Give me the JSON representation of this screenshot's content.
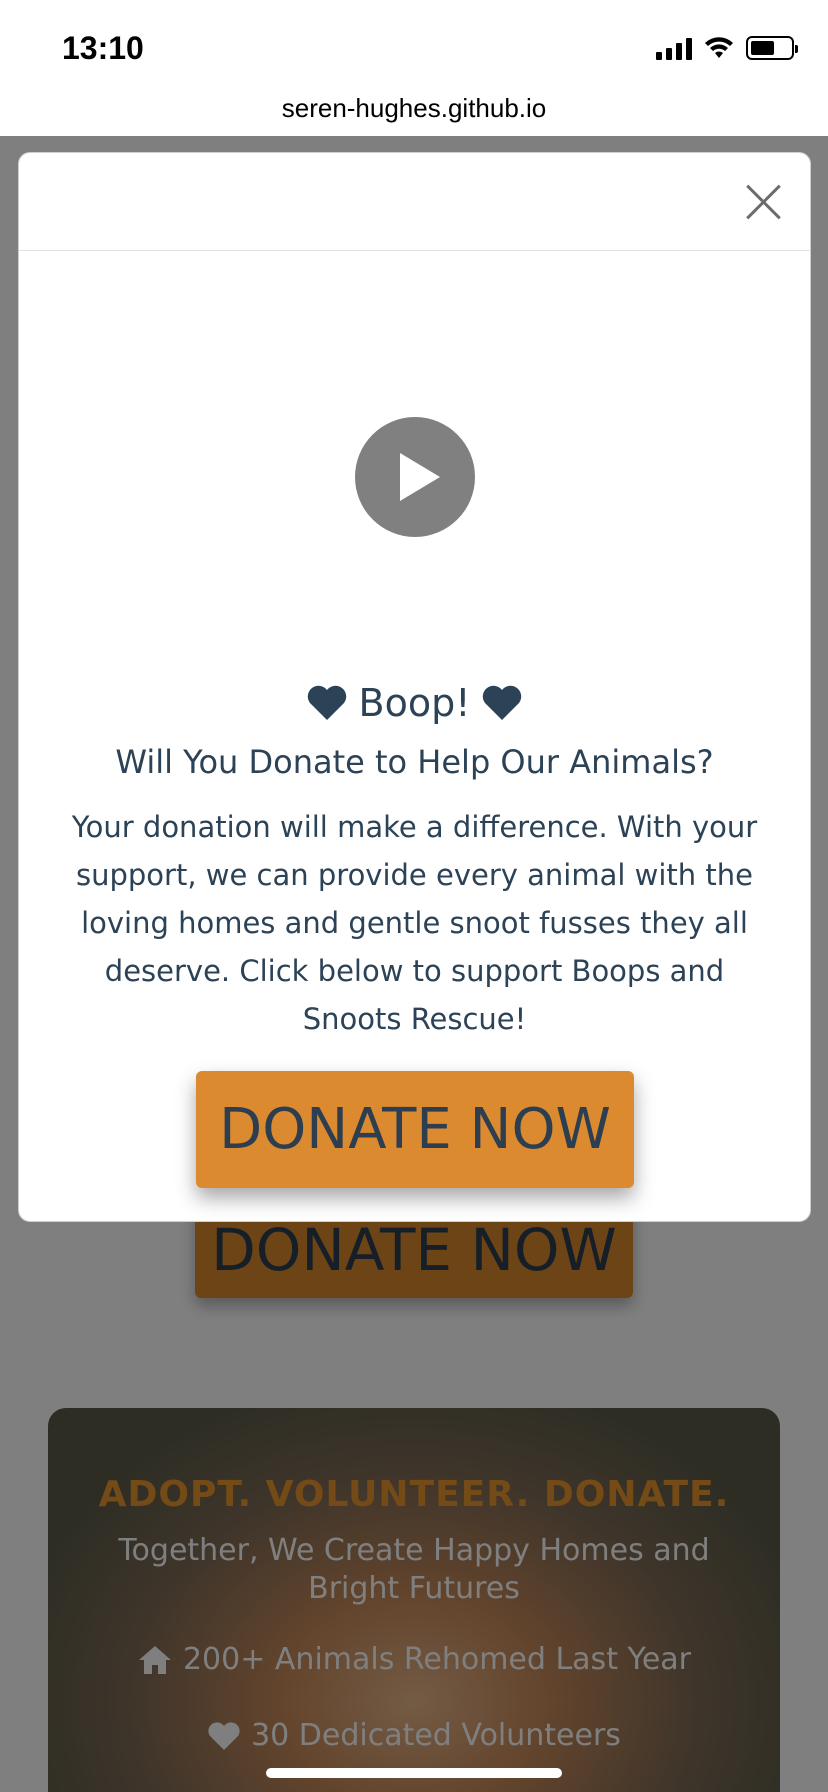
{
  "status_bar": {
    "time": "13:10"
  },
  "browser": {
    "url": "seren-hughes.github.io"
  },
  "background_page": {
    "donate_label": "DONATE NOW",
    "hero": {
      "title": "ADOPT. VOLUNTEER. DONATE.",
      "subtitle": "Together, We Create Happy Homes and Bright Futures",
      "stats": [
        {
          "icon": "home-icon",
          "text": "200+ Animals Rehomed Last Year"
        },
        {
          "icon": "heart-icon",
          "text": "30 Dedicated Volunteers"
        }
      ]
    }
  },
  "modal": {
    "heading": "Boop!",
    "question": "Will You Donate to Help Our Animals?",
    "body": "Your donation will make a difference. With your support, we can provide every animal with the loving homes and gentle snoot fusses they all deserve. Click below to support Boops and Snoots Rescue!",
    "donate_label": "DONATE NOW"
  },
  "colors": {
    "accent": "#dc8a30",
    "text": "#2c4256",
    "hero_title": "#e9942d"
  }
}
